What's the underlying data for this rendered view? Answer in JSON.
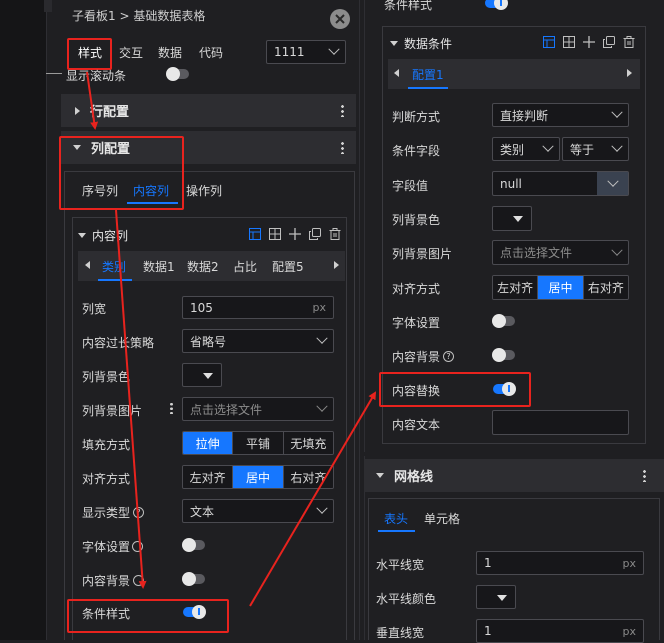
{
  "left": {
    "breadcrumb": "子看板1 > 基础数据表格",
    "tabs": [
      "样式",
      "交互",
      "数据",
      "代码"
    ],
    "version_value": "1111",
    "scroll_label": "显示滚动条",
    "row_config": "行配置",
    "col_config": "列配置",
    "col_tabs": [
      "序号列",
      "内容列",
      "操作列"
    ],
    "content_col_title": "内容列",
    "sub_tabs": [
      "类别",
      "数据1",
      "数据2",
      "占比",
      "配置5"
    ],
    "fields": {
      "col_width": {
        "label": "列宽",
        "value": "105",
        "suffix": "px"
      },
      "overflow": {
        "label": "内容过长策略",
        "value": "省略号"
      },
      "bg_color": {
        "label": "列背景色"
      },
      "bg_image": {
        "label": "列背景图片",
        "placeholder": "点击选择文件"
      },
      "fill": {
        "label": "填充方式",
        "options": [
          "拉伸",
          "平铺",
          "无填充"
        ]
      },
      "align": {
        "label": "对齐方式",
        "options": [
          "左对齐",
          "居中",
          "右对齐"
        ]
      },
      "display_type": {
        "label": "显示类型",
        "value": "文本"
      },
      "font": {
        "label": "字体设置"
      },
      "content_bg": {
        "label": "内容背景"
      },
      "cond_style": {
        "label": "条件样式"
      }
    }
  },
  "right": {
    "cond_style_label": "条件样式",
    "data_cond_title": "数据条件",
    "config_tab": "配置1",
    "fields": {
      "judge": {
        "label": "判断方式",
        "value": "直接判断"
      },
      "cond_field": {
        "label": "条件字段",
        "value": "类别",
        "op": "等于"
      },
      "field_value": {
        "label": "字段值",
        "value": "null"
      },
      "bg_color": {
        "label": "列背景色"
      },
      "bg_image": {
        "label": "列背景图片",
        "placeholder": "点击选择文件"
      },
      "align": {
        "label": "对齐方式",
        "options": [
          "左对齐",
          "居中",
          "右对齐"
        ]
      },
      "font": {
        "label": "字体设置"
      },
      "content_bg": {
        "label": "内容背景"
      },
      "replace": {
        "label": "内容替换"
      },
      "text": {
        "label": "内容文本"
      }
    },
    "grid_title": "网格线",
    "grid_tabs": [
      "表头",
      "单元格"
    ],
    "grid_fields": {
      "h_width": {
        "label": "水平线宽",
        "value": "1",
        "suffix": "px"
      },
      "h_color": {
        "label": "水平线颜色"
      },
      "v_width": {
        "label": "垂直线宽",
        "value": "1",
        "suffix": "px"
      }
    }
  },
  "colors": {
    "accent": "#1677ff",
    "annotation": "#e8231e",
    "panel": "#1f1f22"
  }
}
